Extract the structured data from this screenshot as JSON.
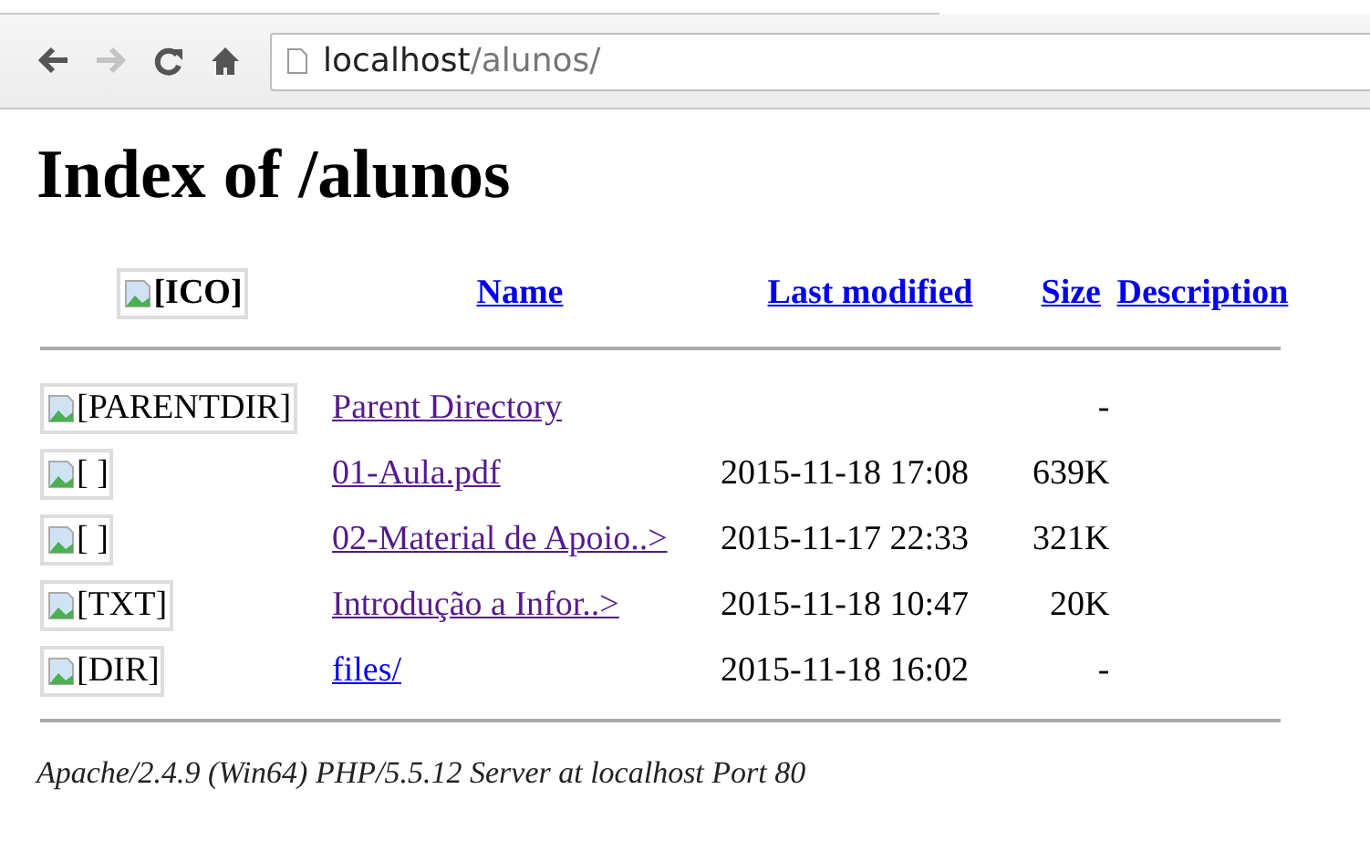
{
  "toolbar": {
    "buttons": [
      {
        "kind": "back",
        "disabled": false
      },
      {
        "kind": "forward",
        "disabled": true
      },
      {
        "kind": "reload",
        "disabled": false
      },
      {
        "kind": "home",
        "disabled": false
      }
    ],
    "address": {
      "host": "localhost",
      "path": "/alunos/"
    }
  },
  "heading": "Index of /alunos",
  "table": {
    "icon_alt": "[ICO]",
    "columns": [
      "Name",
      "Last modified",
      "Size",
      "Description"
    ],
    "rows": [
      {
        "icon_alt": "[PARENTDIR]",
        "name": "Parent Directory",
        "visited": true,
        "size": "-"
      },
      {
        "icon_alt": "[ ]",
        "name": "01-Aula.pdf",
        "visited": true,
        "modified": "2015-11-18 17:08",
        "size": "639K"
      },
      {
        "icon_alt": "[ ]",
        "name": "02-Material de Apoio..>",
        "visited": true,
        "modified": "2015-11-17 22:33",
        "size": "321K"
      },
      {
        "icon_alt": "[TXT]",
        "name": "Introdução a Infor..>",
        "visited": true,
        "modified": "2015-11-18 10:47",
        "size": "20K"
      },
      {
        "icon_alt": "[DIR]",
        "name": "files/",
        "visited": false,
        "modified": "2015-11-18 16:02",
        "size": "-"
      }
    ]
  },
  "footer": "Apache/2.4.9 (Win64) PHP/5.5.12 Server at localhost Port 80"
}
